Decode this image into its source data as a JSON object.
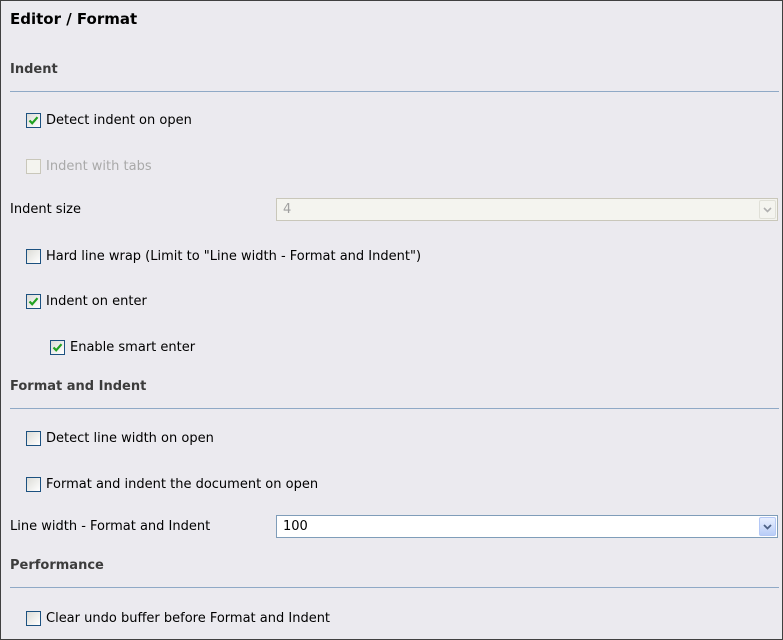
{
  "title": "Editor / Format",
  "sections": {
    "indent": {
      "heading": "Indent",
      "detect_indent": {
        "label": "Detect indent on open",
        "checked": true,
        "enabled": true
      },
      "indent_tabs": {
        "label": "Indent with tabs",
        "checked": false,
        "enabled": false
      },
      "indent_size": {
        "label": "Indent size",
        "value": "4",
        "enabled": false
      },
      "hard_wrap": {
        "label": "Hard line wrap (Limit to \"Line width - Format and Indent\")",
        "checked": false,
        "enabled": true
      },
      "indent_enter": {
        "label": "Indent on enter",
        "checked": true,
        "enabled": true
      },
      "smart_enter": {
        "label": "Enable smart enter",
        "checked": true,
        "enabled": true
      }
    },
    "format": {
      "heading": "Format and Indent",
      "detect_width": {
        "label": "Detect line width on open",
        "checked": false,
        "enabled": true
      },
      "format_on_open": {
        "label": "Format and indent the document on open",
        "checked": false,
        "enabled": true
      },
      "line_width": {
        "label": "Line width - Format and Indent",
        "value": "100",
        "enabled": true
      }
    },
    "performance": {
      "heading": "Performance",
      "clear_undo": {
        "label": "Clear undo buffer before Format and Indent",
        "checked": false,
        "enabled": true
      }
    }
  },
  "icons": {
    "check": "checkmark-icon",
    "dropdown": "chevron-down-icon"
  },
  "colors": {
    "check": "#21a121",
    "accent": "#1c5180",
    "rule": "#8fa9c6"
  }
}
